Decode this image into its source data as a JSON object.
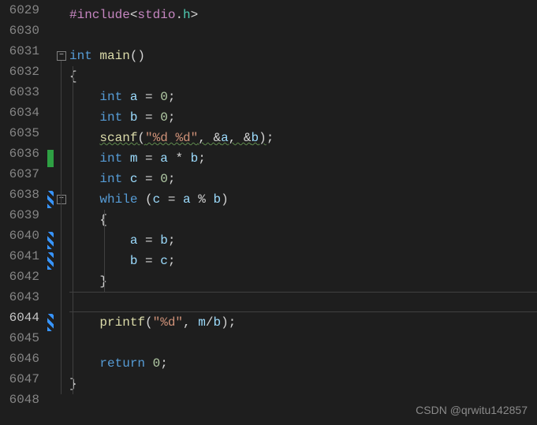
{
  "lines": [
    {
      "num": "6029",
      "indent": 0,
      "tokens": []
    },
    {
      "num": "6030",
      "indent": 0,
      "tokens": [
        {
          "t": "#include",
          "c": "pp"
        },
        {
          "t": "<",
          "c": "punct"
        },
        {
          "t": "stdio",
          "c": "hdr1"
        },
        {
          "t": ".",
          "c": "punct"
        },
        {
          "t": "h",
          "c": "hdr2"
        },
        {
          "t": ">",
          "c": "punct"
        }
      ]
    },
    {
      "num": "6031",
      "indent": 0,
      "tokens": []
    },
    {
      "num": "6032",
      "indent": 0,
      "fold": true,
      "tokens": [
        {
          "t": "int",
          "c": "kw"
        },
        {
          "t": " ",
          "c": ""
        },
        {
          "t": "main",
          "c": "fn"
        },
        {
          "t": "()",
          "c": "punct"
        }
      ]
    },
    {
      "num": "6033",
      "indent": 0,
      "guide": true,
      "tokens": [
        {
          "t": "{",
          "c": "punct"
        }
      ]
    },
    {
      "num": "6034",
      "indent": 1,
      "guide": true,
      "tokens": [
        {
          "t": "int",
          "c": "kw"
        },
        {
          "t": " ",
          "c": ""
        },
        {
          "t": "a",
          "c": "var"
        },
        {
          "t": " = ",
          "c": "op"
        },
        {
          "t": "0",
          "c": "num"
        },
        {
          "t": ";",
          "c": "punct"
        }
      ]
    },
    {
      "num": "6035",
      "indent": 1,
      "guide": true,
      "tokens": [
        {
          "t": "int",
          "c": "kw"
        },
        {
          "t": " ",
          "c": ""
        },
        {
          "t": "b",
          "c": "var"
        },
        {
          "t": " = ",
          "c": "op"
        },
        {
          "t": "0",
          "c": "num"
        },
        {
          "t": ";",
          "c": "punct"
        }
      ]
    },
    {
      "num": "6036",
      "indent": 1,
      "guide": true,
      "tokens": [
        {
          "t": "scanf",
          "c": "fn wavy"
        },
        {
          "t": "(",
          "c": "punct wavy"
        },
        {
          "t": "\"%d %d\"",
          "c": "str wavy"
        },
        {
          "t": ", &",
          "c": "punct wavy"
        },
        {
          "t": "a",
          "c": "var wavy"
        },
        {
          "t": ", &",
          "c": "punct wavy"
        },
        {
          "t": "b",
          "c": "var wavy"
        },
        {
          "t": ")",
          "c": "punct wavy"
        },
        {
          "t": ";",
          "c": "punct"
        }
      ]
    },
    {
      "num": "6037",
      "indent": 1,
      "guide": true,
      "mark": "green",
      "tokens": [
        {
          "t": "int",
          "c": "kw"
        },
        {
          "t": " ",
          "c": ""
        },
        {
          "t": "m",
          "c": "var"
        },
        {
          "t": " = ",
          "c": "op"
        },
        {
          "t": "a",
          "c": "var"
        },
        {
          "t": " * ",
          "c": "op"
        },
        {
          "t": "b",
          "c": "var"
        },
        {
          "t": ";",
          "c": "punct"
        }
      ]
    },
    {
      "num": "6038",
      "indent": 1,
      "guide": true,
      "tokens": [
        {
          "t": "int",
          "c": "kw"
        },
        {
          "t": " ",
          "c": ""
        },
        {
          "t": "c",
          "c": "var"
        },
        {
          "t": " = ",
          "c": "op"
        },
        {
          "t": "0",
          "c": "num"
        },
        {
          "t": ";",
          "c": "punct"
        }
      ]
    },
    {
      "num": "6039",
      "indent": 1,
      "guide": true,
      "mark": "blue",
      "fold": true,
      "tokens": [
        {
          "t": "while",
          "c": "kw"
        },
        {
          "t": " (",
          "c": "punct"
        },
        {
          "t": "c",
          "c": "var"
        },
        {
          "t": " = ",
          "c": "op"
        },
        {
          "t": "a",
          "c": "var"
        },
        {
          "t": " % ",
          "c": "op"
        },
        {
          "t": "b",
          "c": "var"
        },
        {
          "t": ")",
          "c": "punct"
        }
      ]
    },
    {
      "num": "6040",
      "indent": 1,
      "guide": true,
      "guide2": true,
      "tokens": [
        {
          "t": "{",
          "c": "punct"
        }
      ]
    },
    {
      "num": "6041",
      "indent": 2,
      "guide": true,
      "guide2": true,
      "mark": "blue",
      "tokens": [
        {
          "t": "a",
          "c": "var"
        },
        {
          "t": " = ",
          "c": "op"
        },
        {
          "t": "b",
          "c": "var"
        },
        {
          "t": ";",
          "c": "punct"
        }
      ]
    },
    {
      "num": "6042",
      "indent": 2,
      "guide": true,
      "guide2": true,
      "mark": "blue",
      "tokens": [
        {
          "t": "b",
          "c": "var"
        },
        {
          "t": " = ",
          "c": "op"
        },
        {
          "t": "c",
          "c": "var"
        },
        {
          "t": ";",
          "c": "punct"
        }
      ]
    },
    {
      "num": "6043",
      "indent": 1,
      "guide": true,
      "guide2": true,
      "tokens": [
        {
          "t": "}",
          "c": "punct"
        }
      ]
    },
    {
      "num": "6044",
      "indent": 1,
      "guide": true,
      "active": true,
      "tokens": []
    },
    {
      "num": "6045",
      "indent": 1,
      "guide": true,
      "mark": "blue",
      "tokens": [
        {
          "t": "printf",
          "c": "fn"
        },
        {
          "t": "(",
          "c": "punct"
        },
        {
          "t": "\"%d\"",
          "c": "str"
        },
        {
          "t": ", ",
          "c": "punct"
        },
        {
          "t": "m",
          "c": "var"
        },
        {
          "t": "/",
          "c": "op"
        },
        {
          "t": "b",
          "c": "var"
        },
        {
          "t": ");",
          "c": "punct"
        }
      ]
    },
    {
      "num": "6046",
      "indent": 1,
      "guide": true,
      "tokens": []
    },
    {
      "num": "6047",
      "indent": 1,
      "guide": true,
      "tokens": [
        {
          "t": "return",
          "c": "kw"
        },
        {
          "t": " ",
          "c": ""
        },
        {
          "t": "0",
          "c": "num"
        },
        {
          "t": ";",
          "c": "punct"
        }
      ]
    },
    {
      "num": "6048",
      "indent": 0,
      "guide": true,
      "tokens": [
        {
          "t": "}",
          "c": "punct"
        }
      ]
    }
  ],
  "watermark": "CSDN @qrwitu142857"
}
